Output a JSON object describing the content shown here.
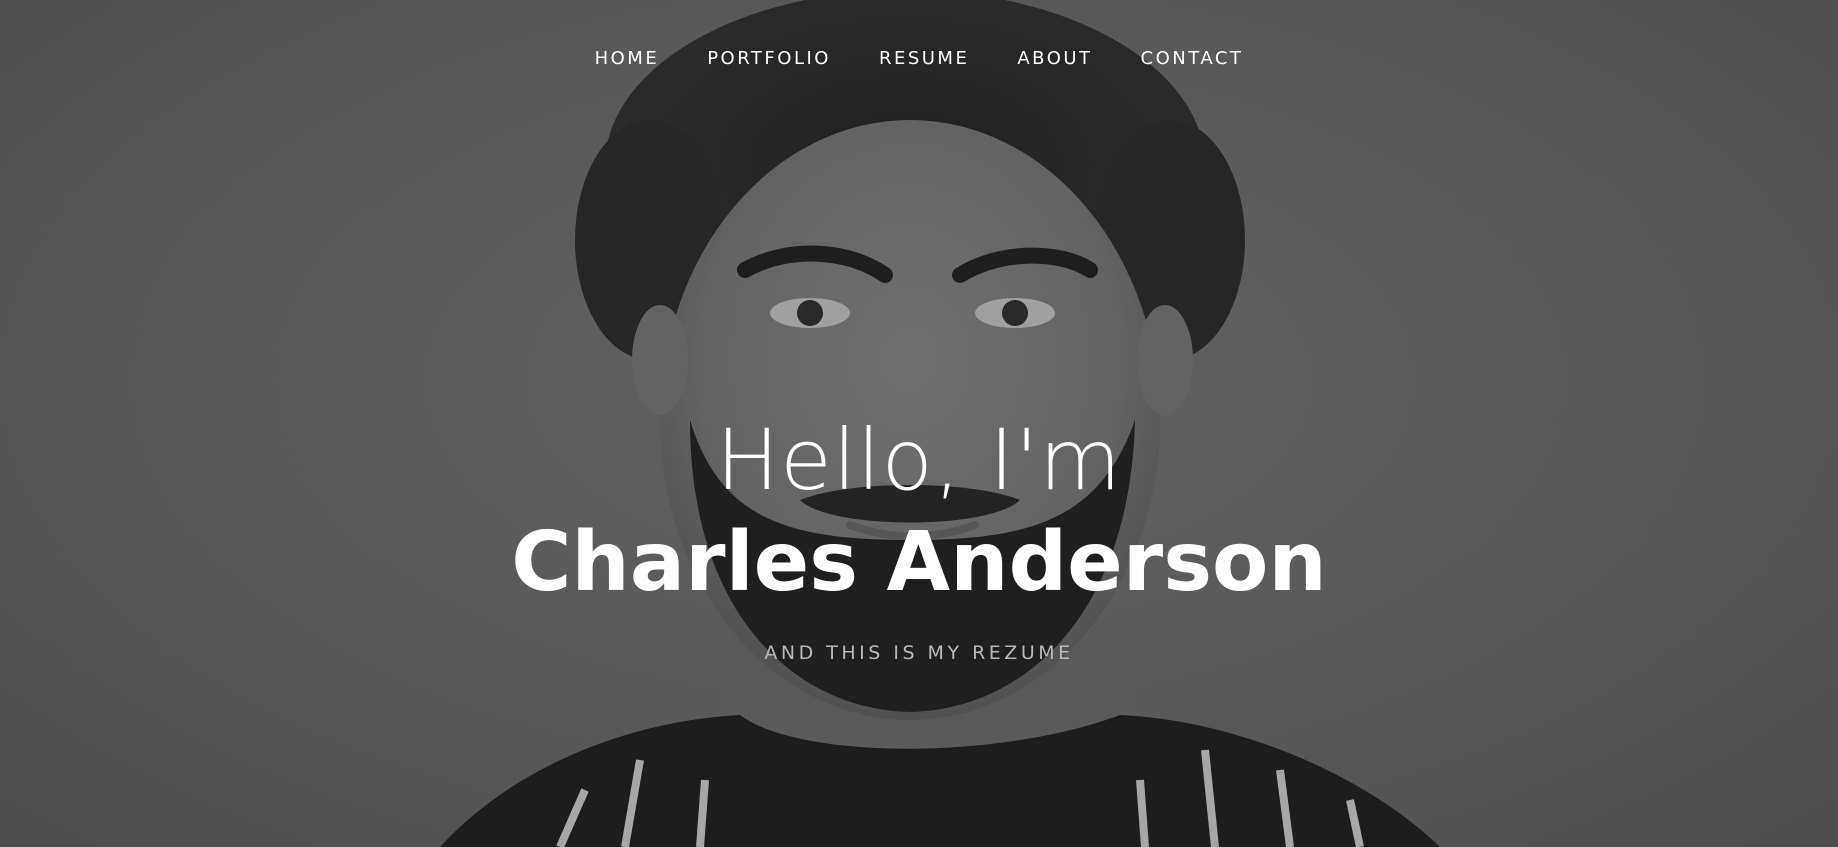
{
  "nav": {
    "items": [
      {
        "label": "HOME"
      },
      {
        "label": "PORTFOLIO"
      },
      {
        "label": "RESUME"
      },
      {
        "label": "ABOUT"
      },
      {
        "label": "CONTACT"
      }
    ]
  },
  "hero": {
    "greeting": "Hello, I'm",
    "name": "Charles Anderson",
    "tagline": "AND THIS IS MY REZUME",
    "background_image": "grayscale-portrait-photo"
  },
  "colors": {
    "text_primary": "#ffffff",
    "tagline": "#b9b9b9",
    "background": "#6f6f6f"
  }
}
